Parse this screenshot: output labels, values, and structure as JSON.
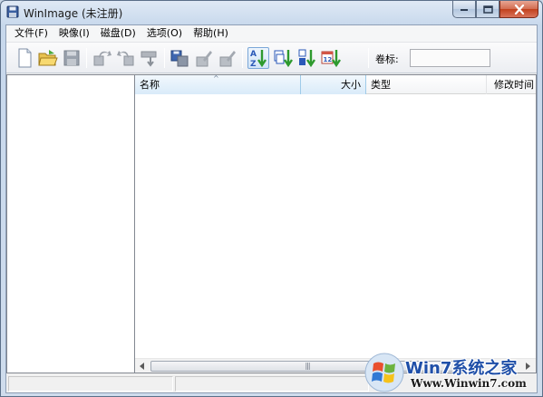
{
  "window": {
    "title": "WinImage (未注册)"
  },
  "menubar": {
    "items": [
      {
        "label": "文件(F)"
      },
      {
        "label": "映像(I)"
      },
      {
        "label": "磁盘(D)"
      },
      {
        "label": "选项(O)"
      },
      {
        "label": "帮助(H)"
      }
    ]
  },
  "toolbar": {
    "volume_label": "卷标:",
    "volume_value": ""
  },
  "list": {
    "columns": [
      {
        "label": "名称"
      },
      {
        "label": "大小"
      },
      {
        "label": "类型"
      },
      {
        "label": "修改时间"
      }
    ],
    "sort_indicator": "^",
    "rows": []
  },
  "scrollbar": {
    "grip": "|||"
  },
  "watermark": {
    "brand": "Win7系统之家",
    "url": "Www.Winwin7.com"
  },
  "colors": {
    "accent": "#1f4fa8",
    "close_button": "#c1401d"
  }
}
